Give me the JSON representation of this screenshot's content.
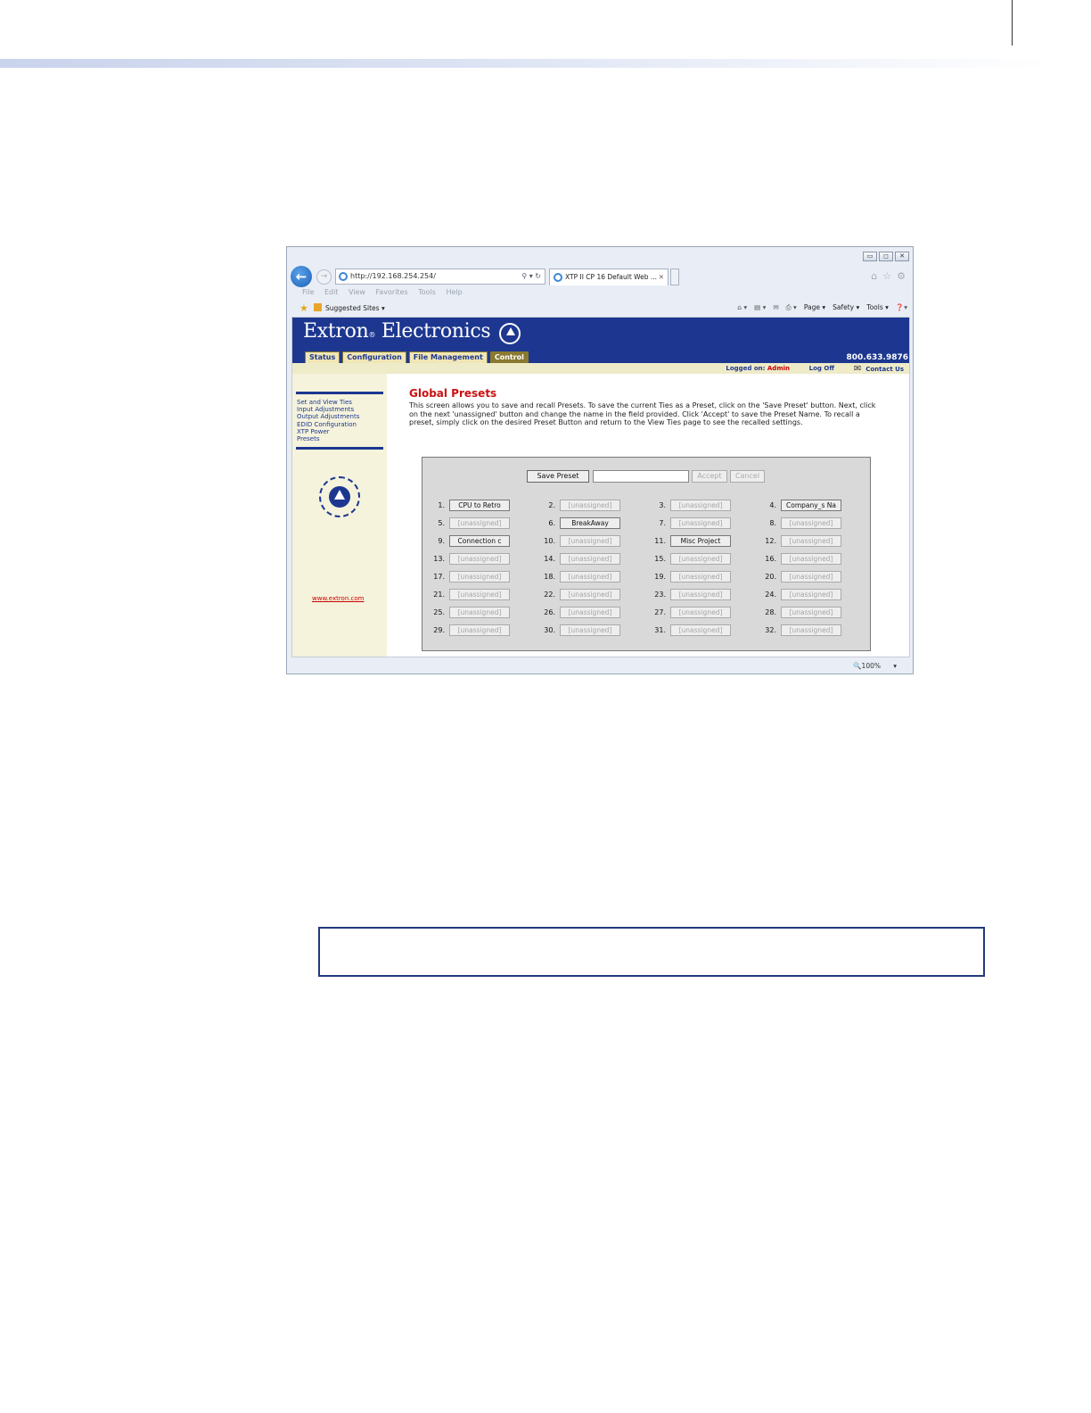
{
  "browser": {
    "url": "http://192.168.254.254/",
    "tab_title": "XTP II CP 16 Default Web ...",
    "window_buttons": [
      "▭",
      "◻",
      "✕"
    ],
    "menus": [
      "File",
      "Edit",
      "View",
      "Favorites",
      "Tools",
      "Help"
    ],
    "favorites_label": "Suggested Sites ▾",
    "command_bar": [
      "Page ▾",
      "Safety ▾",
      "Tools ▾"
    ],
    "zoom": "🔍100%"
  },
  "site": {
    "brand": "Extron",
    "brand_suffix": "Electronics",
    "phone": "800.633.9876",
    "tabs": [
      "Status",
      "Configuration",
      "File Management",
      "Control"
    ],
    "logged_on_label": "Logged on:",
    "logged_on_user": "Admin",
    "log_off": "Log Off",
    "contact_us": "Contact Us",
    "sidebar_links": [
      "Set and View Ties",
      "Input Adjustments",
      "Output Adjustments",
      "EDID Configuration",
      "XTP Power",
      "Presets"
    ],
    "website": "www.extron.com"
  },
  "main": {
    "title": "Global Presets",
    "description": "This screen allows you to save and recall Presets. To save the current Ties as a Preset, click on the 'Save Preset' button. Next, click on the next 'unassigned' button and change the name in the field provided. Click 'Accept' to save the Preset Name. To recall a preset, simply click on the desired Preset Button and return to the View Ties page to see the recalled settings."
  },
  "presets": {
    "save_label": "Save Preset",
    "name_value": "",
    "accept_label": "Accept",
    "cancel_label": "Cancel",
    "items": [
      {
        "num": "1.",
        "label": "CPU to Retro",
        "assigned": true
      },
      {
        "num": "2.",
        "label": "[unassigned]",
        "assigned": false
      },
      {
        "num": "3.",
        "label": "[unassigned]",
        "assigned": false
      },
      {
        "num": "4.",
        "label": "Company_s Na",
        "assigned": true
      },
      {
        "num": "5.",
        "label": "[unassigned]",
        "assigned": false
      },
      {
        "num": "6.",
        "label": "BreakAway",
        "assigned": true
      },
      {
        "num": "7.",
        "label": "[unassigned]",
        "assigned": false
      },
      {
        "num": "8.",
        "label": "[unassigned]",
        "assigned": false
      },
      {
        "num": "9.",
        "label": "Connection c",
        "assigned": true
      },
      {
        "num": "10.",
        "label": "[unassigned]",
        "assigned": false
      },
      {
        "num": "11.",
        "label": "Misc Project",
        "assigned": true
      },
      {
        "num": "12.",
        "label": "[unassigned]",
        "assigned": false
      },
      {
        "num": "13.",
        "label": "[unassigned]",
        "assigned": false
      },
      {
        "num": "14.",
        "label": "[unassigned]",
        "assigned": false
      },
      {
        "num": "15.",
        "label": "[unassigned]",
        "assigned": false
      },
      {
        "num": "16.",
        "label": "[unassigned]",
        "assigned": false
      },
      {
        "num": "17.",
        "label": "[unassigned]",
        "assigned": false
      },
      {
        "num": "18.",
        "label": "[unassigned]",
        "assigned": false
      },
      {
        "num": "19.",
        "label": "[unassigned]",
        "assigned": false
      },
      {
        "num": "20.",
        "label": "[unassigned]",
        "assigned": false
      },
      {
        "num": "21.",
        "label": "[unassigned]",
        "assigned": false
      },
      {
        "num": "22.",
        "label": "[unassigned]",
        "assigned": false
      },
      {
        "num": "23.",
        "label": "[unassigned]",
        "assigned": false
      },
      {
        "num": "24.",
        "label": "[unassigned]",
        "assigned": false
      },
      {
        "num": "25.",
        "label": "[unassigned]",
        "assigned": false
      },
      {
        "num": "26.",
        "label": "[unassigned]",
        "assigned": false
      },
      {
        "num": "27.",
        "label": "[unassigned]",
        "assigned": false
      },
      {
        "num": "28.",
        "label": "[unassigned]",
        "assigned": false
      },
      {
        "num": "29.",
        "label": "[unassigned]",
        "assigned": false
      },
      {
        "num": "30.",
        "label": "[unassigned]",
        "assigned": false
      },
      {
        "num": "31.",
        "label": "[unassigned]",
        "assigned": false
      },
      {
        "num": "32.",
        "label": "[unassigned]",
        "assigned": false
      }
    ]
  }
}
